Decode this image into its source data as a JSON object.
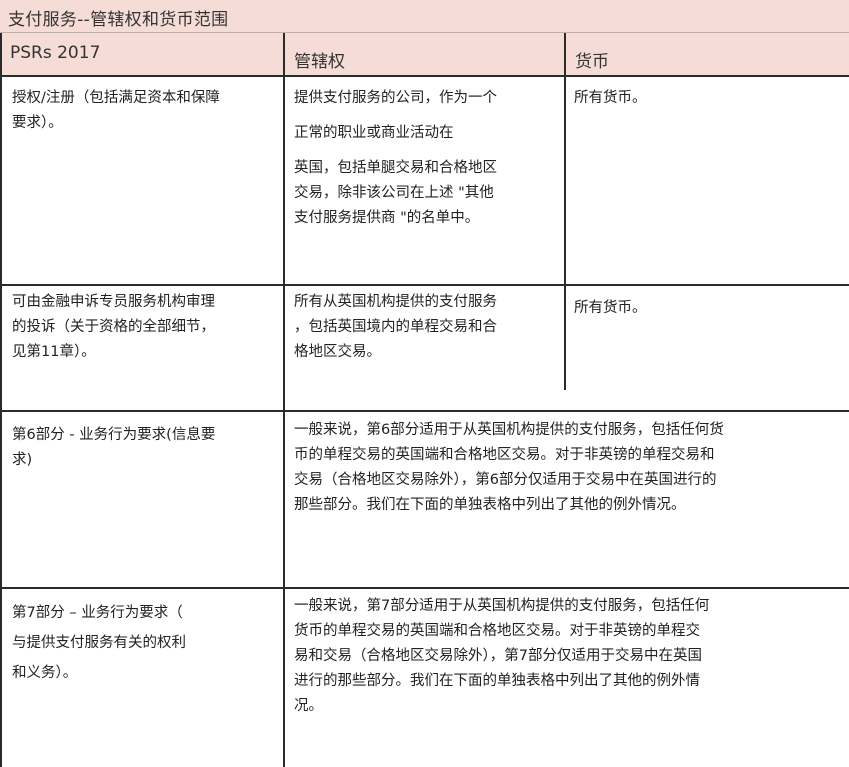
{
  "title": "支付服务--管辖权和货币范围",
  "headers": {
    "col1": "PSRs 2017",
    "col2": "管辖权",
    "col3": "货币"
  },
  "rows": [
    {
      "c1": [
        "授权/注册（包括满足资本和保障",
        "要求）。"
      ],
      "c2": [
        "提供支付服务的公司，作为一个",
        "正常的职业或商业活动在",
        "英国，包括单腿交易和合格地区",
        "交易，除非该公司在上述 \"其他",
        "支付服务提供商 \"的名单中。"
      ],
      "c3": [
        "所有货币。"
      ]
    },
    {
      "c1": [
        "可由金融申诉专员服务机构审理",
        "的投诉（关于资格的全部细节，",
        "见第11章）。"
      ],
      "c2": [
        "所有从英国机构提供的支付服务",
        "，包括英国境内的单程交易和合",
        "格地区交易。"
      ],
      "c3": [
        "所有货币。"
      ]
    },
    {
      "c1": [
        "第6部分 - 业务行为要求(信息要",
        "求)"
      ],
      "c2": [
        "一般来说，第6部分适用于从英国机构提供的支付服务，包括任何货",
        "币的单程交易的英国端和合格地区交易。对于非英镑的单程交易和",
        "交易（合格地区交易除外），第6部分仅适用于交易中在英国进行的",
        "那些部分。我们在下面的单独表格中列出了其他的例外情况。"
      ]
    },
    {
      "c1": [
        "第7部分 – 业务行为要求（",
        "与提供支付服务有关的权利",
        "和义务）。"
      ],
      "c2": [
        "一般来说，第7部分适用于从英国机构提供的支付服务，包括任何",
        "货币的单程交易的英国端和合格地区交易。对于非英镑的单程交",
        "易和交易（合格地区交易除外），第7部分仅适用于交易中在英国",
        "进行的那些部分。我们在下面的单独表格中列出了其他的例外情",
        "况。"
      ]
    }
  ]
}
